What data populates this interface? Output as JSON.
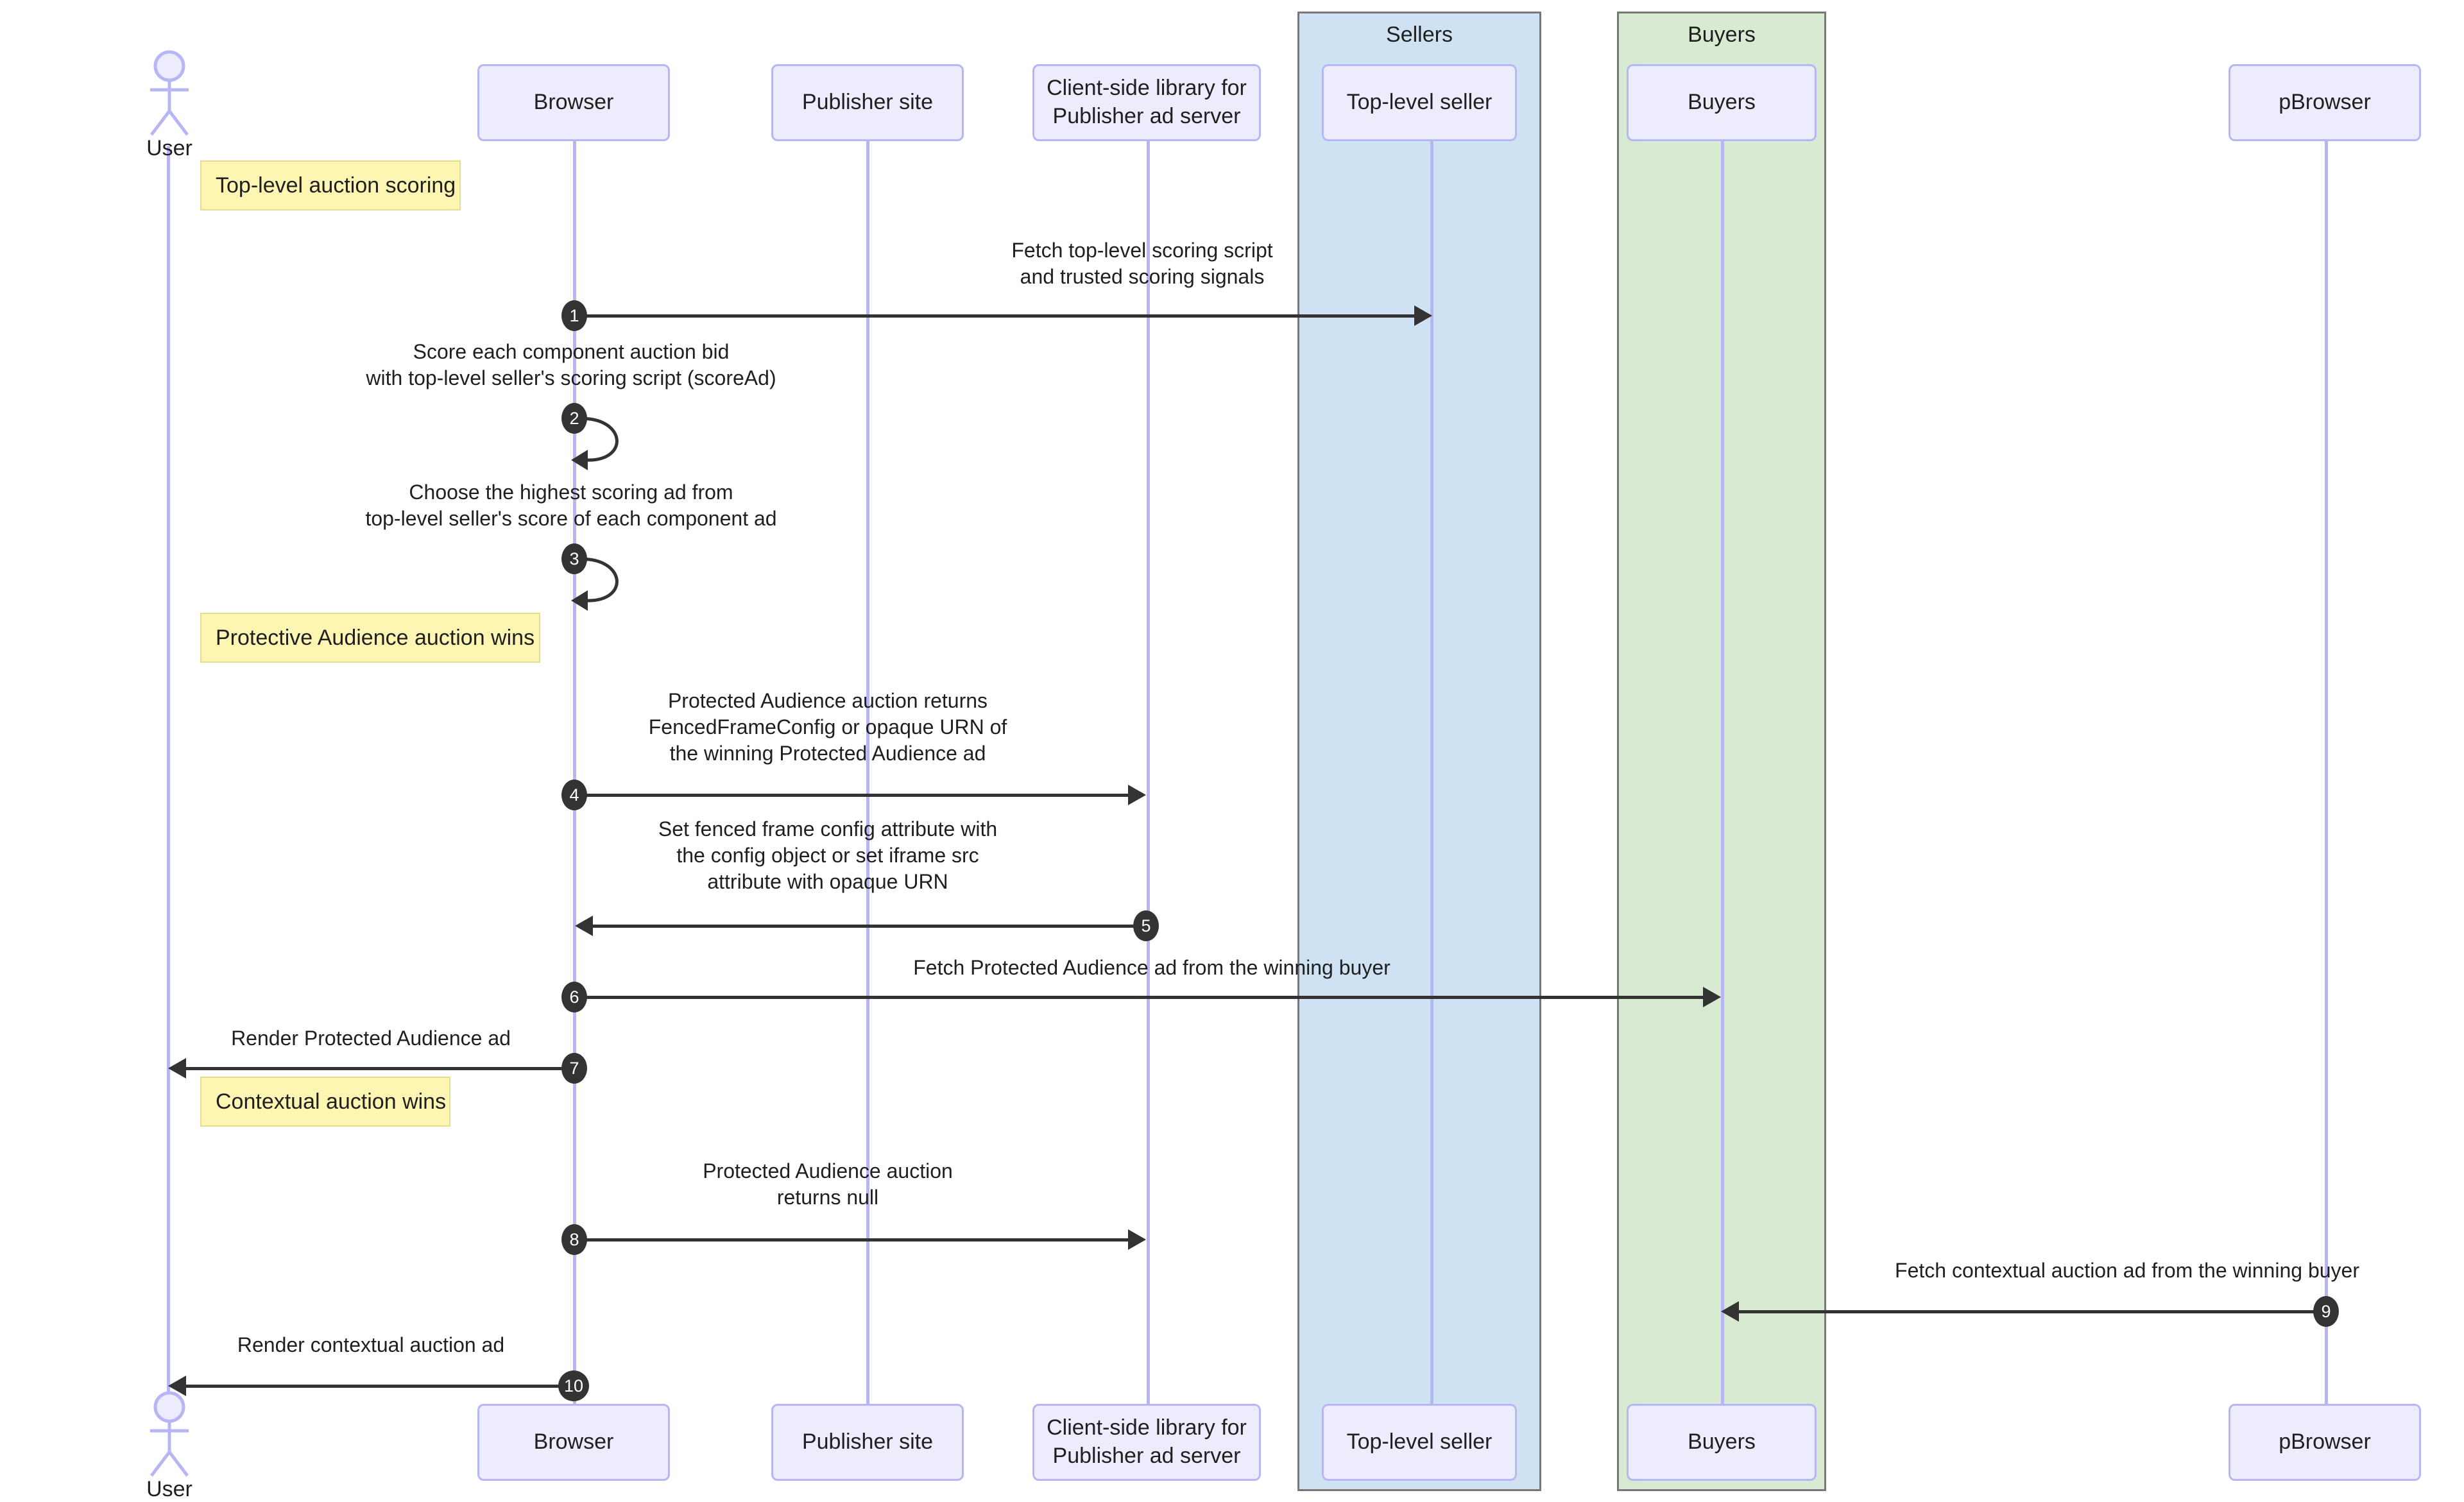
{
  "diagram": {
    "type": "sequence-diagram",
    "title": "Protected Audience top-level auction sequence"
  },
  "groups": [
    {
      "name": "sellers-group",
      "label": "Sellers",
      "color": "#cfe2f3"
    },
    {
      "name": "buyers-group",
      "label": "Buyers",
      "color": "#d9ead3"
    }
  ],
  "participants": [
    {
      "id": "user",
      "label": "User",
      "kind": "actor"
    },
    {
      "id": "browser",
      "label": "Browser",
      "kind": "box"
    },
    {
      "id": "pubsite",
      "label": "Publisher site",
      "kind": "box"
    },
    {
      "id": "clientlib",
      "label": "Client-side library for\nPublisher ad server",
      "kind": "box"
    },
    {
      "id": "tlseller",
      "label": "Top-level seller",
      "kind": "box"
    },
    {
      "id": "buyers",
      "label": "Buyers",
      "kind": "box"
    },
    {
      "id": "pbrowser",
      "label": "pBrowser",
      "kind": "box"
    }
  ],
  "notes": [
    {
      "id": "note-1",
      "text": "Top-level auction scoring"
    },
    {
      "id": "note-2",
      "text": "Protective Audience auction wins"
    },
    {
      "id": "note-3",
      "text": "Contextual auction wins"
    }
  ],
  "messages": [
    {
      "num": "1",
      "text": "Fetch top-level scoring script\nand trusted scoring signals"
    },
    {
      "num": "2",
      "text": "Score each component auction bid\nwith top-level seller's scoring script (scoreAd)"
    },
    {
      "num": "3",
      "text": "Choose the highest scoring ad from\ntop-level seller's score of each component ad"
    },
    {
      "num": "4",
      "text": "Protected Audience auction returns\nFencedFrameConfig or opaque URN of\nthe winning Protected Audience ad"
    },
    {
      "num": "5",
      "text": "Set fenced frame config attribute with\nthe config object or set iframe src\nattribute with opaque URN"
    },
    {
      "num": "6",
      "text": "Fetch Protected Audience ad from the winning buyer"
    },
    {
      "num": "7",
      "text": "Render Protected Audience ad"
    },
    {
      "num": "8",
      "text": "Protected Audience auction\nreturns null"
    },
    {
      "num": "9",
      "text": "Fetch contextual auction ad from the winning buyer"
    },
    {
      "num": "10",
      "text": "Render contextual auction ad"
    }
  ],
  "colors": {
    "participant_fill": "#ececfc",
    "participant_border": "#b6b6f5",
    "lifeline": "#b6b6f5",
    "note_fill": "#fdf6b2",
    "note_border": "#e6dc8e",
    "arrow": "#333333",
    "sellers_group_fill": "#cfe2f3",
    "buyers_group_fill": "#d9ead3",
    "group_border": "#777777"
  }
}
